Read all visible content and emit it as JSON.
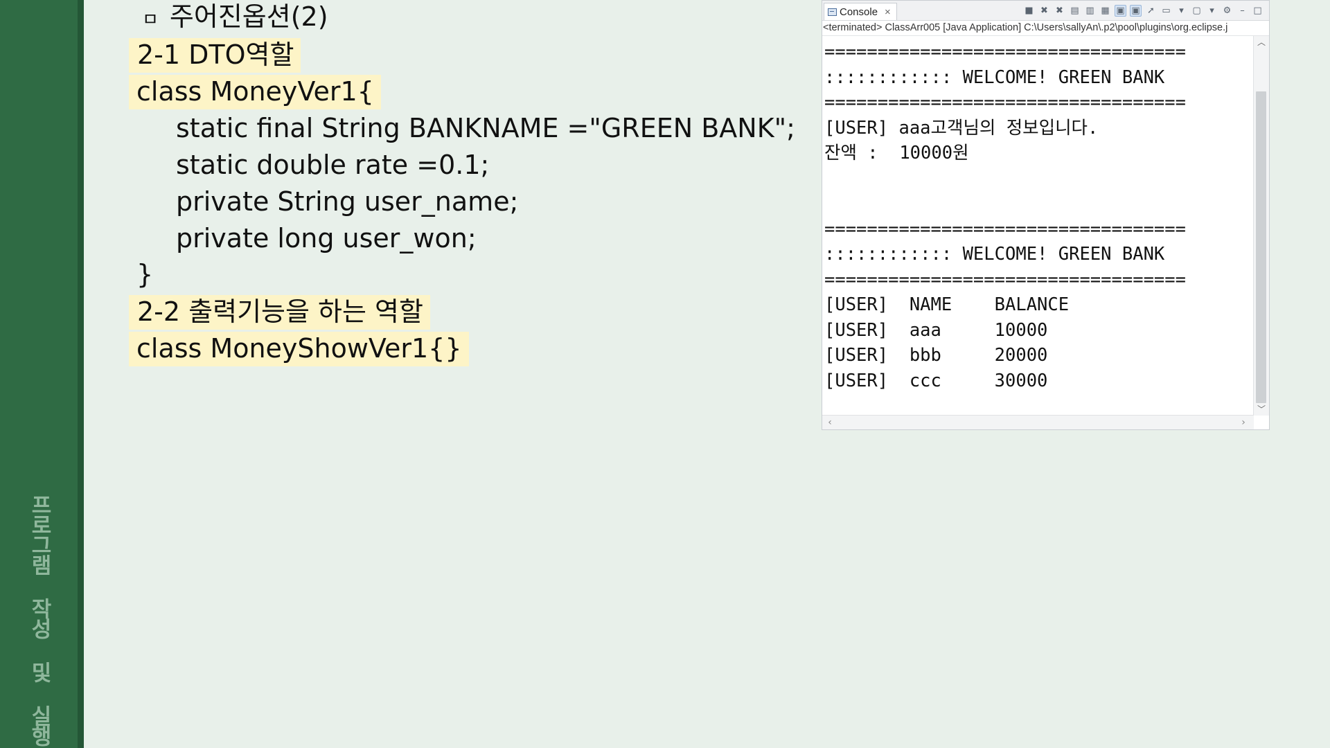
{
  "sidebar": {
    "title": "프로그램 작성 및 실행"
  },
  "slide": {
    "heading_bullet": "ㅁ",
    "heading": "주어진옵션(2)",
    "section1_title": "2-1 DTO역할",
    "class1_open": "class MoneyVer1{",
    "fields": [
      "static final String BANKNAME =\"GREEN BANK\";",
      "static double rate =0.1;",
      "private String user_name;",
      "private long user_won;"
    ],
    "class1_close": "}",
    "section2_title": "2-2 출력기능을 하는 역할",
    "class2": "class MoneyShowVer1{}"
  },
  "console": {
    "tab_label": "Console",
    "tab_close": "×",
    "toolbar_icons": [
      "terminate-icon",
      "remove-launch-icon",
      "remove-all-icon",
      "clear-console-icon",
      "scroll-lock-icon",
      "word-wrap-icon",
      "show-on-stdout-icon",
      "show-on-stderr-icon",
      "pin-console-icon",
      "display-selected-icon",
      "open-console-icon",
      "view-menu-icon",
      "minimize-icon",
      "maximize-icon"
    ],
    "status": "<terminated> ClassArr005 [Java Application] C:\\Users\\sallyAn\\.p2\\pool\\plugins\\org.eclipse.j",
    "output": [
      "==================================",
      ":::::::::::: WELCOME! GREEN BANK",
      "==================================",
      "[USER] aaa고객님의 정보입니다.",
      "잔액 :  10000원",
      "",
      "",
      "==================================",
      ":::::::::::: WELCOME! GREEN BANK",
      "==================================",
      "[USER]  NAME    BALANCE",
      "[USER]  aaa     10000",
      "[USER]  bbb     20000",
      "[USER]  ccc     30000"
    ]
  },
  "colors": {
    "sidebar": "#2f6b44",
    "background": "#e8f0ea",
    "highlight": "#fdf4c7"
  }
}
